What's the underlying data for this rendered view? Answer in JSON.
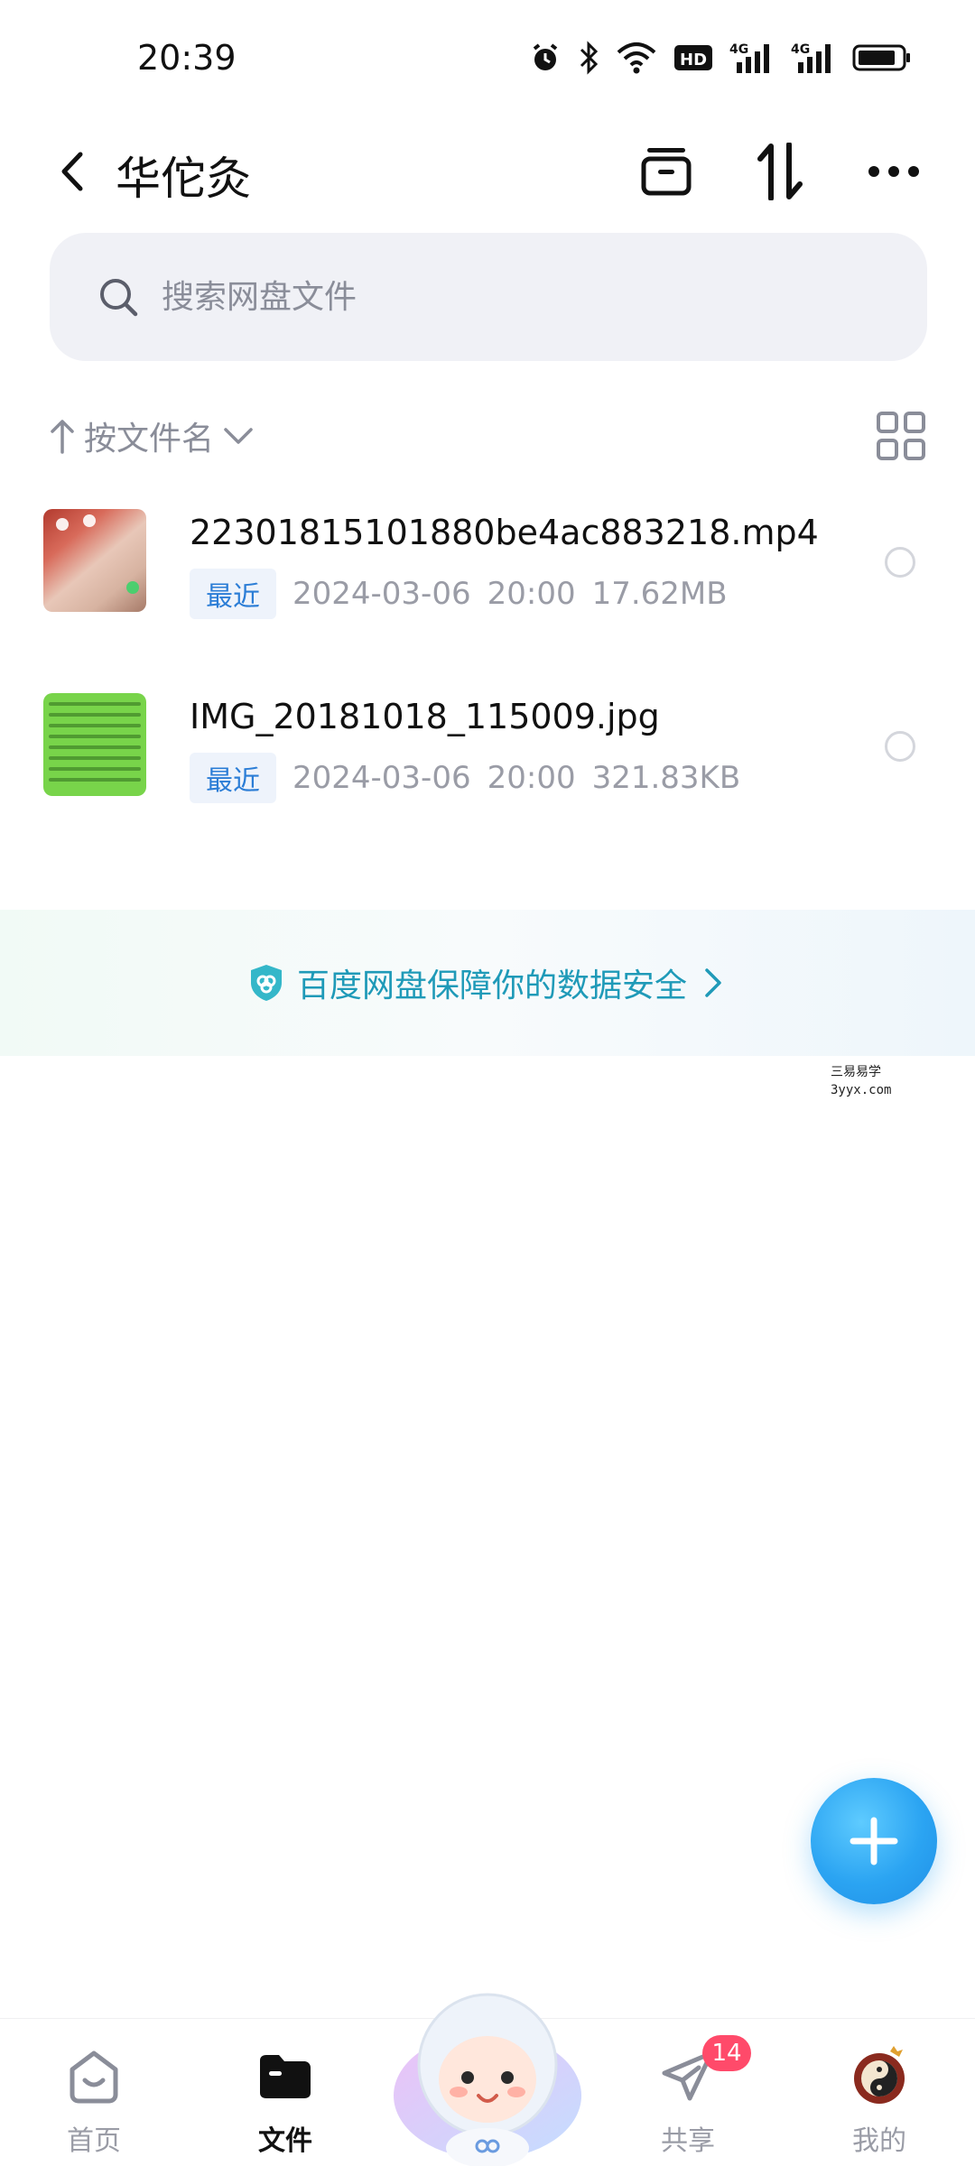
{
  "status_bar": {
    "time": "20:39",
    "icons": [
      "alarm-icon",
      "bluetooth-icon",
      "wifi-icon",
      "hd-icon",
      "signal-4g-icon",
      "signal-4g-icon",
      "battery-icon"
    ]
  },
  "header": {
    "title": "华佗灸",
    "actions": [
      "archive-icon",
      "sort-icon",
      "more-icon"
    ]
  },
  "search": {
    "placeholder": "搜索网盘文件",
    "value": ""
  },
  "sort": {
    "label": "按文件名"
  },
  "files": [
    {
      "name": "22301815101880be4ac883218.mp4",
      "badge": "最近",
      "date": "2024-03-06",
      "time": "20:00",
      "size": "17.62MB",
      "thumbnail": "video"
    },
    {
      "name": "IMG_20181018_115009.jpg",
      "badge": "最近",
      "date": "2024-03-06",
      "time": "20:00",
      "size": "321.83KB",
      "thumbnail": "image"
    }
  ],
  "security_banner": {
    "text": "百度网盘保障你的数据安全"
  },
  "watermark": {
    "line1": "三易易学",
    "line2": "3yyx.com"
  },
  "bottom_nav": {
    "items": [
      {
        "label": "首页",
        "icon": "home-icon",
        "active": false
      },
      {
        "label": "文件",
        "icon": "folder-icon",
        "active": true
      },
      {
        "label": "共享",
        "icon": "share-icon",
        "active": false,
        "badge": "14"
      },
      {
        "label": "我的",
        "icon": "avatar",
        "active": false
      }
    ]
  },
  "colors": {
    "accent": "#2ba4f2",
    "badge_red": "#ff4a6a",
    "security_text": "#1f9ab8",
    "recent_badge_text": "#2b7dd6"
  }
}
